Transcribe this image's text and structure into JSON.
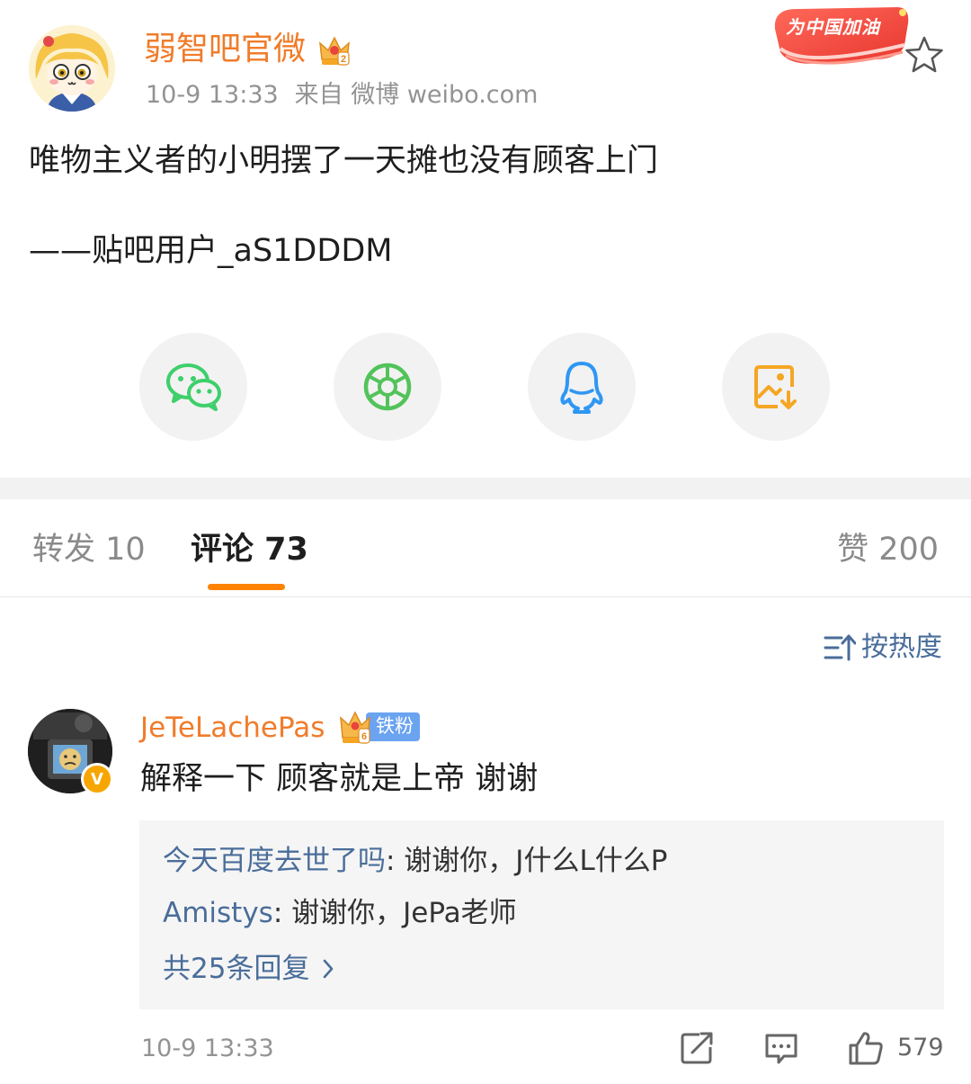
{
  "post": {
    "author": "弱智吧官微",
    "time": "10-9 13:33",
    "source": "来自 微博 weibo.com",
    "promo_badge": "为中国加油",
    "text_line1": "唯物主义者的小明摆了一天摊也没有顾客上门",
    "text_line2": "——贴吧用户_aS1DDDM"
  },
  "share": {
    "icons": [
      "wechat-icon",
      "moments-icon",
      "qq-icon",
      "save-image-icon"
    ]
  },
  "tabs": {
    "repost": "转发 10",
    "comment": "评论 73",
    "like": "赞 200"
  },
  "sort": {
    "label": "按热度"
  },
  "comment": {
    "user": "JeTeLachePas",
    "fan_badge": "铁粉",
    "verified": "V",
    "text": "解释一下 顾客就是上帝 谢谢",
    "replies": [
      {
        "user": "今天百度去世了吗",
        "text": ": 谢谢你，J什么L什么P"
      },
      {
        "user": "Amistys",
        "text": ": 谢谢你，JePa老师"
      }
    ],
    "more_replies": "共25条回复",
    "time": "10-9 13:33",
    "like_count": "579"
  },
  "colors": {
    "accent_orange": "#f07c2b",
    "tab_underline": "#ff8200",
    "link_blue": "#4a6d9a",
    "wechat_green": "#3ecf6b",
    "moments_green": "#52c35a",
    "qq_blue": "#2f97f3",
    "save_orange": "#f5a623"
  }
}
